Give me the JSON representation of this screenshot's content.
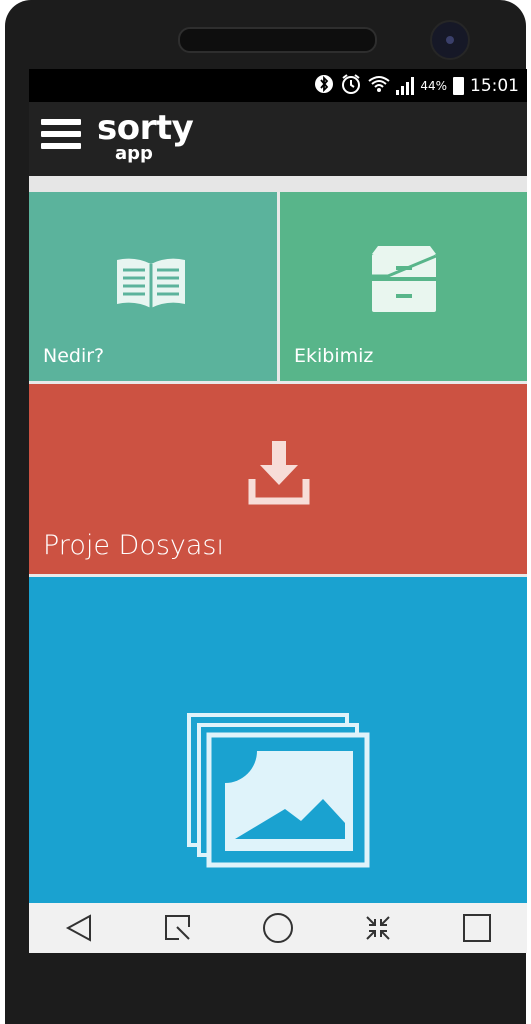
{
  "status_bar": {
    "battery_percent": "44%",
    "time": "15:01",
    "icons": [
      "bluetooth-icon",
      "alarm-icon",
      "wifi-icon",
      "signal-icon",
      "battery-icon"
    ]
  },
  "app_bar": {
    "logo_line1": "sorty",
    "logo_line2": "app",
    "menu_icon": "hamburger-menu-icon"
  },
  "tiles": [
    {
      "label": "Nedir?",
      "icon": "open-book-icon",
      "color": "#5bb39c"
    },
    {
      "label": "Ekibimiz",
      "icon": "file-cabinet-icon",
      "color": "#58b58a"
    },
    {
      "label": "Proje Dosyası",
      "icon": "download-icon",
      "color": "#cc5242"
    },
    {
      "label": "",
      "icon": "image-gallery-icon",
      "color": "#1aa2d0"
    }
  ],
  "nav_bar": {
    "buttons": [
      "back-icon",
      "quickmemo-icon",
      "home-icon",
      "dual-window-icon",
      "recent-apps-icon"
    ]
  }
}
